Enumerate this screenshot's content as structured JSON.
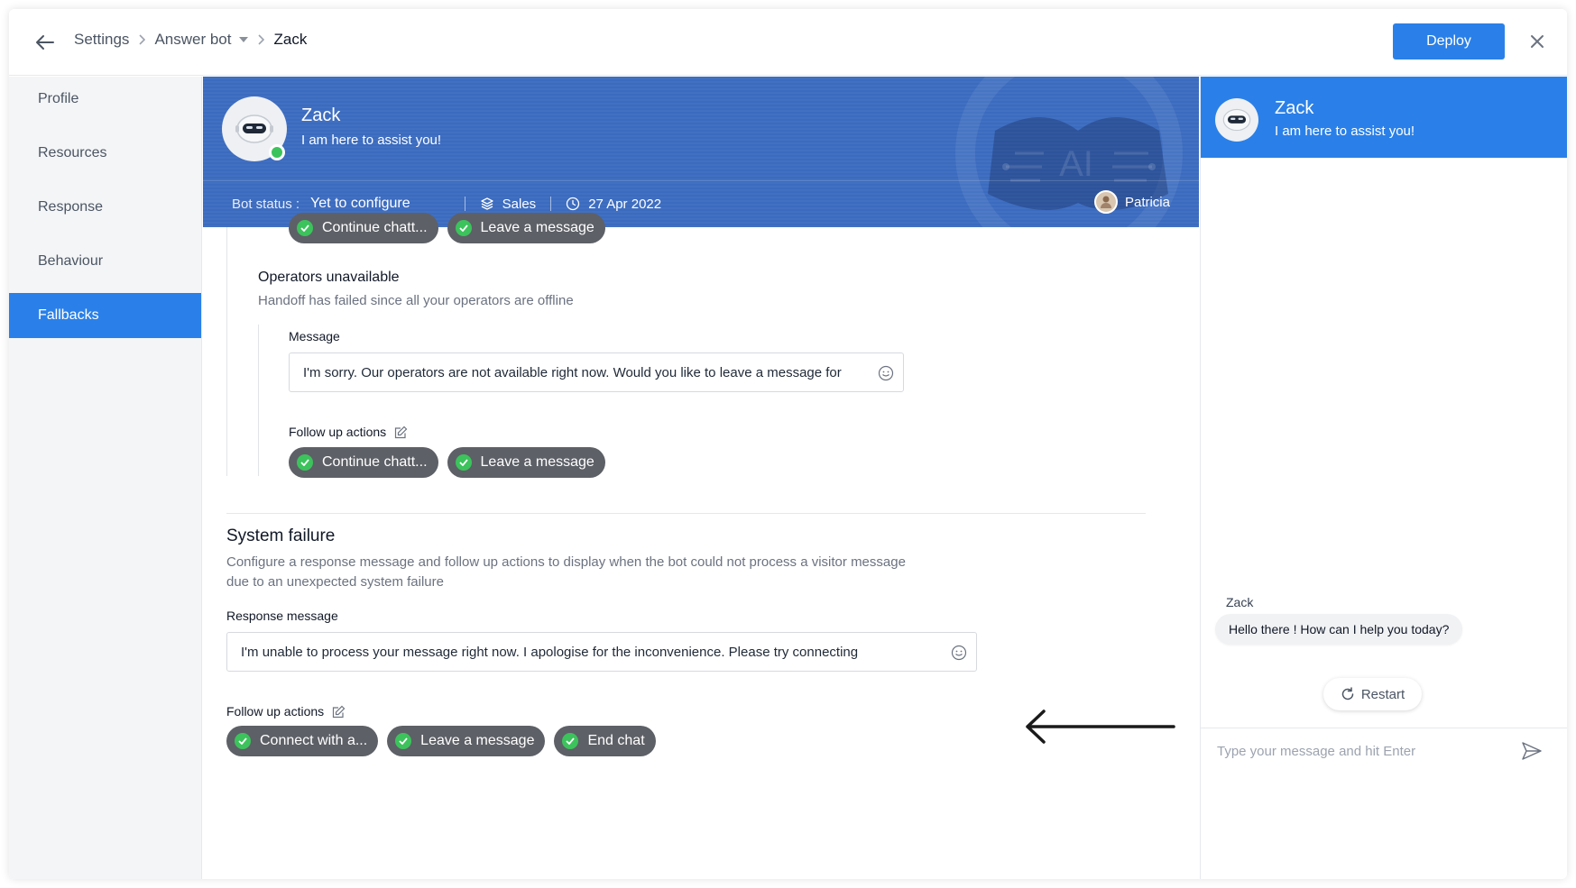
{
  "breadcrumb": {
    "settings": "Settings",
    "answer_bot": "Answer bot",
    "current": "Zack"
  },
  "toolbar": {
    "deploy_label": "Deploy"
  },
  "sidebar": {
    "items": [
      {
        "label": "Profile",
        "active": false
      },
      {
        "label": "Resources",
        "active": false
      },
      {
        "label": "Response",
        "active": false
      },
      {
        "label": "Behaviour",
        "active": false
      },
      {
        "label": "Fallbacks",
        "active": true
      }
    ]
  },
  "bot": {
    "name": "Zack",
    "tagline": "I am here to assist you!",
    "status_label": "Bot status :",
    "status_value": "Yet to configure",
    "department": "Sales",
    "date": "27 Apr 2022",
    "owner": "Patricia",
    "art_text": "AI"
  },
  "top_chips": [
    "Continue chatt...",
    "Leave a message"
  ],
  "operators_unavailable": {
    "title": "Operators unavailable",
    "description": "Handoff has failed since all your operators are offline",
    "message_label": "Message",
    "message_value": "I'm sorry. Our operators are not available right now. Would you like to leave a message for",
    "follow_label": "Follow up actions",
    "chips": [
      "Continue chatt...",
      "Leave a message"
    ]
  },
  "system_failure": {
    "title": "System failure",
    "description_line1": "Configure a response message and follow up actions to display when the bot could not process a visitor message",
    "description_line2": "due to an unexpected system failure",
    "response_label": "Response message",
    "response_value": "I'm unable to process your message right now. I apologise for the inconvenience. Please try connecting",
    "follow_label": "Follow up actions",
    "chips": [
      "Connect with a...",
      "Leave a message",
      "End chat"
    ]
  },
  "preview": {
    "name": "Zack",
    "tagline": "I am here to assist you!",
    "sender": "Zack",
    "greeting": "Hello there ! How can I help you today?",
    "restart_label": "Restart",
    "input_placeholder": "Type your message and hit Enter"
  },
  "colors": {
    "accent": "#2a80e8",
    "hero": "#3b6bbf",
    "chip": "#5d6066",
    "success": "#3cc35c"
  },
  "icons": [
    "back-arrow-icon",
    "chevron-right-icon",
    "close-icon",
    "robot-icon",
    "layers-icon",
    "clock-icon",
    "check-icon",
    "emoji-icon",
    "edit-icon",
    "refresh-icon",
    "send-icon",
    "arrow-left-icon"
  ]
}
